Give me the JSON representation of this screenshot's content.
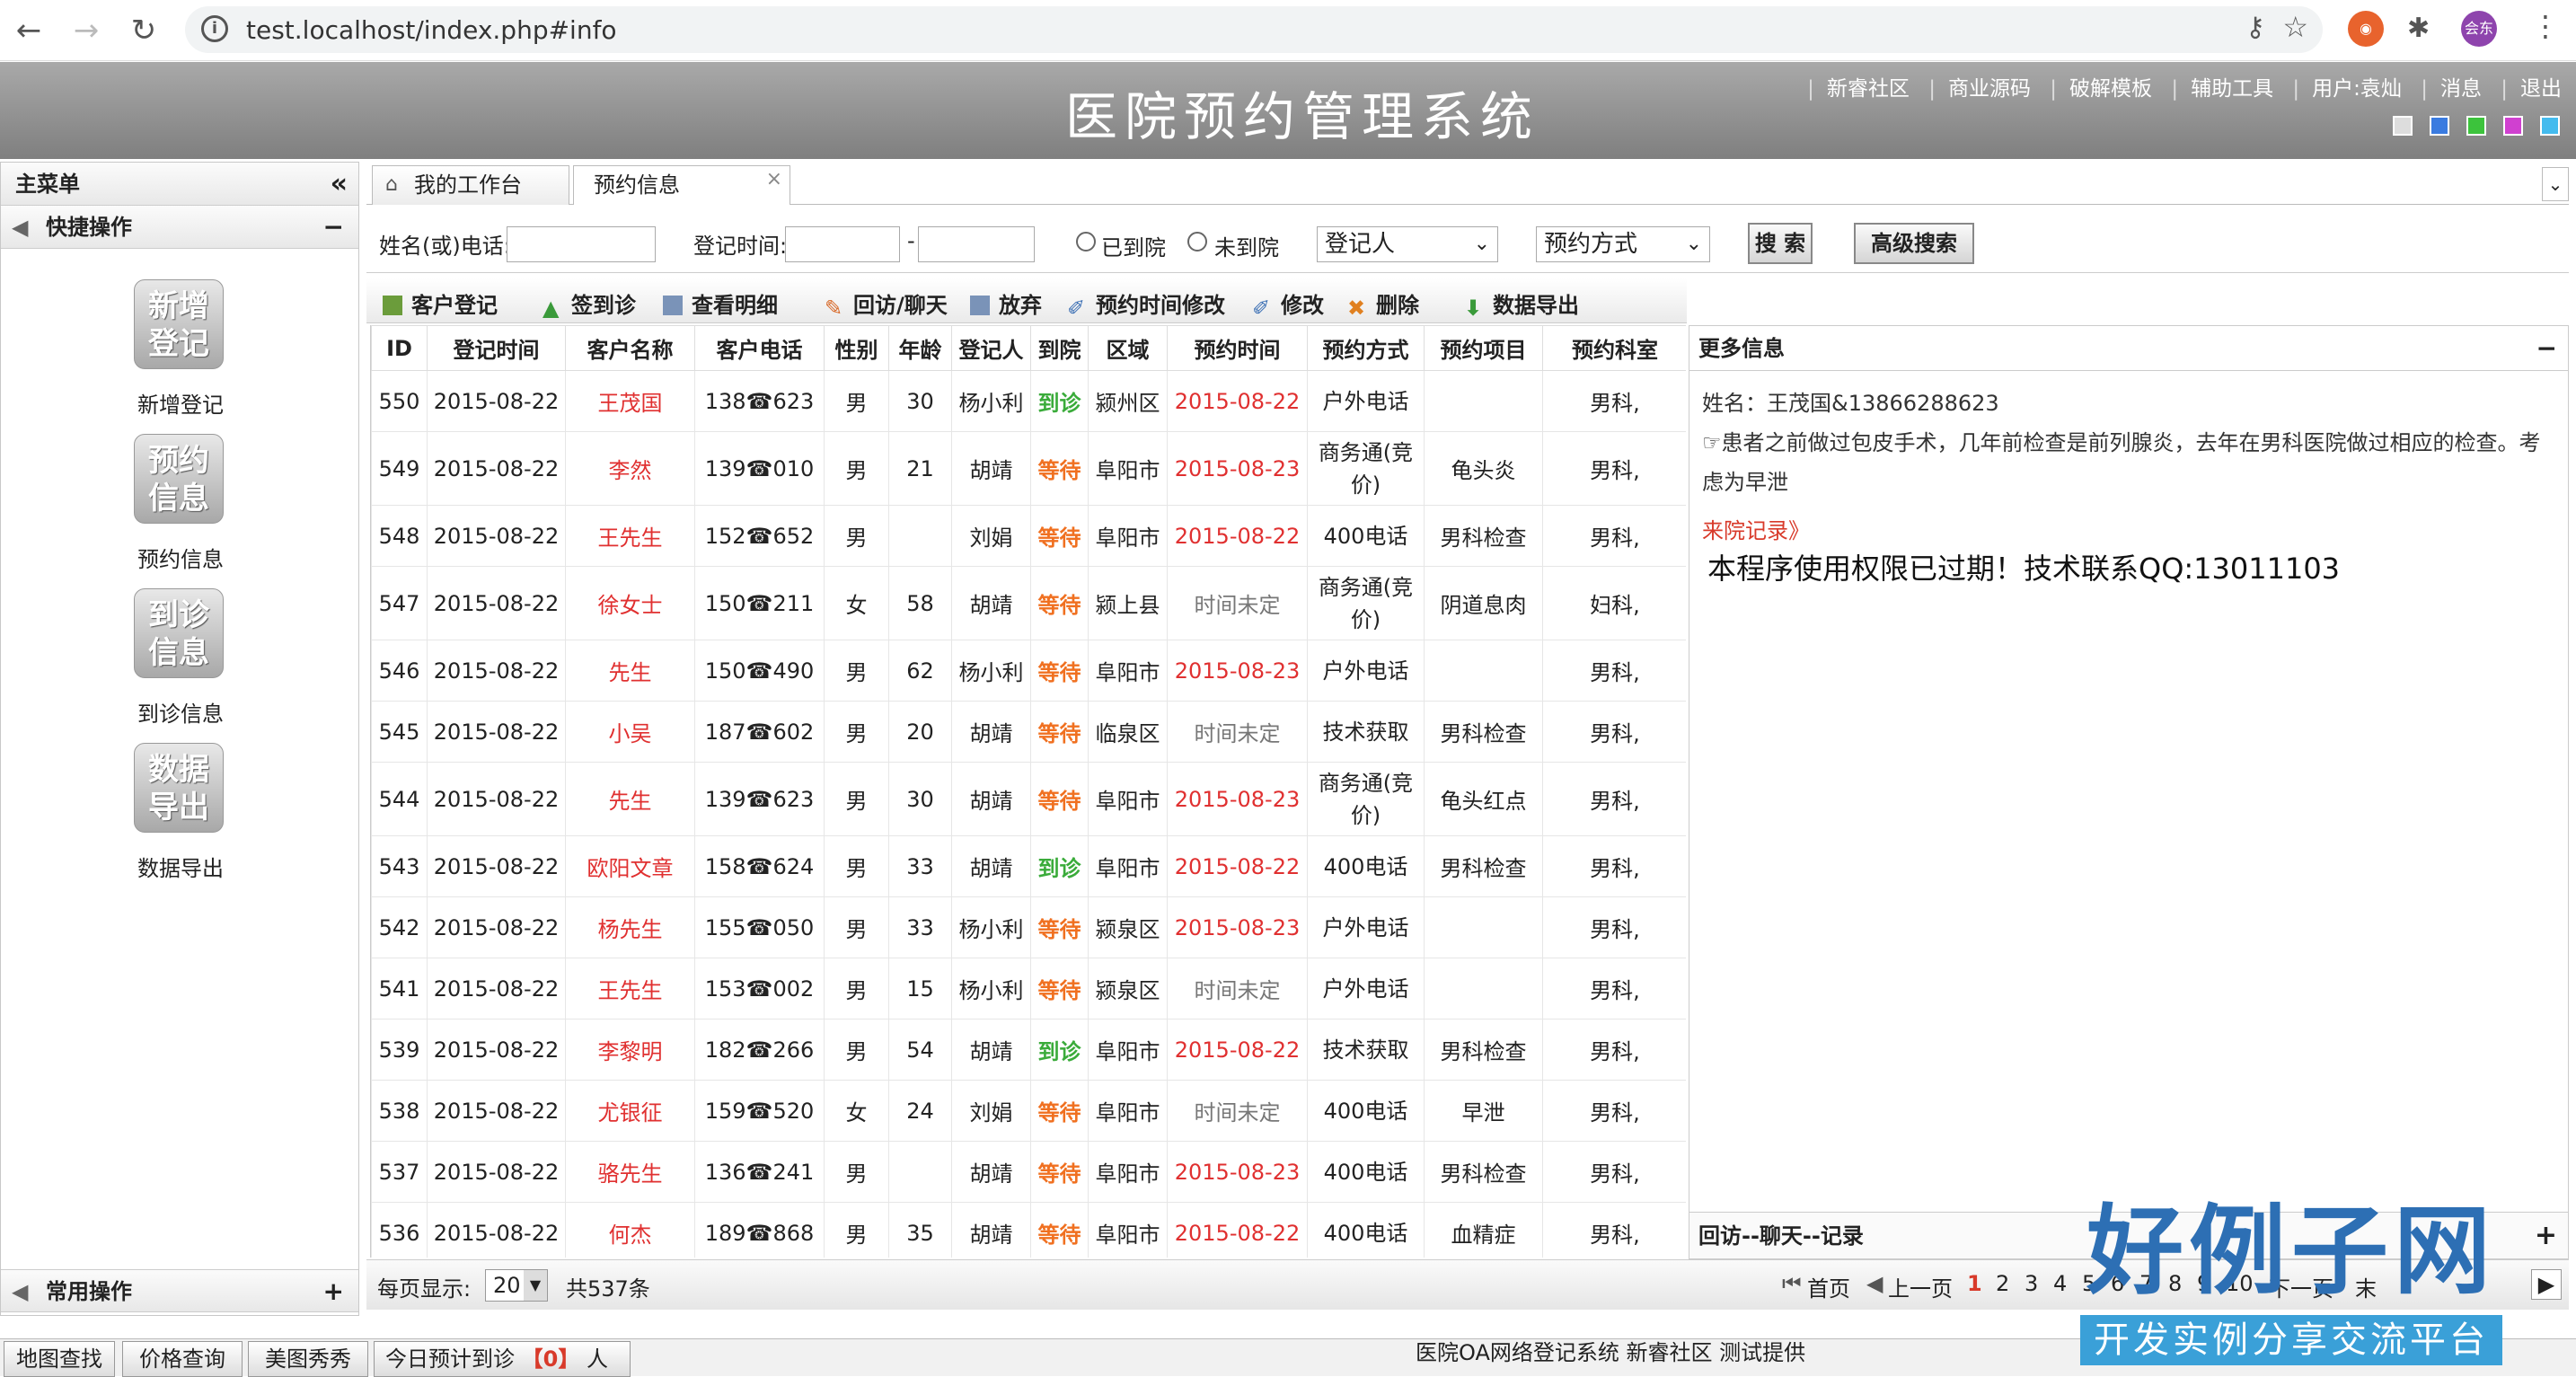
{
  "browser": {
    "url": "test.localhost/index.php#info",
    "profile_label": "会东"
  },
  "header": {
    "title": "医院预约管理系统",
    "nav": [
      "新睿社区",
      "商业源码",
      "破解模板",
      "辅助工具",
      "用户:袁灿",
      "消息",
      "退出"
    ],
    "skin_colors": [
      "#dddddd",
      "#3a7be0",
      "#3cc33c",
      "#d040d0",
      "#44bbee"
    ]
  },
  "sidebar": {
    "main_menu": "主菜单",
    "quick_ops": "快捷操作",
    "items": [
      {
        "icon_text": "新增\n登记",
        "label": "新增登记"
      },
      {
        "icon_text": "预约\n信息",
        "label": "预约信息"
      },
      {
        "icon_text": "到诊\n信息",
        "label": "到诊信息"
      },
      {
        "icon_text": "数据\n导出",
        "label": "数据导出"
      }
    ],
    "common_ops": "常用操作"
  },
  "tabs": [
    {
      "label": "我的工作台"
    },
    {
      "label": "预约信息"
    }
  ],
  "search": {
    "name_phone_label": "姓名(或)电话:",
    "reg_time_label": "登记时间:",
    "dash": "-",
    "radio_arrived": "已到院",
    "radio_not_arrived": "未到院",
    "registrar_select": "登记人",
    "method_select": "预约方式",
    "search_btn": "搜 索",
    "advanced_btn": "高级搜索"
  },
  "toolbar": [
    "客户登记",
    "签到诊",
    "查看明细",
    "回访/聊天",
    "放弃",
    "预约时间修改",
    "修改",
    "删除",
    "数据导出"
  ],
  "table": {
    "columns": [
      "ID",
      "登记时间",
      "客户名称",
      "客户电话",
      "性别",
      "年龄",
      "登记人",
      "到院",
      "区域",
      "预约时间",
      "预约方式",
      "预约项目",
      "预约科室"
    ],
    "rows": [
      [
        "550",
        "2015-08-22",
        "王茂国",
        "138☎623",
        "男",
        "30",
        "杨小利",
        "到诊",
        "颍州区",
        "2015-08-22",
        "户外电话",
        "",
        "男科,"
      ],
      [
        "549",
        "2015-08-22",
        "李然",
        "139☎010",
        "男",
        "21",
        "胡靖",
        "等待",
        "阜阳市",
        "2015-08-23",
        "商务通(竞价)",
        "龟头炎",
        "男科,"
      ],
      [
        "548",
        "2015-08-22",
        "王先生",
        "152☎652",
        "男",
        "",
        "刘娟",
        "等待",
        "阜阳市",
        "2015-08-22",
        "400电话",
        "男科检查",
        "男科,"
      ],
      [
        "547",
        "2015-08-22",
        "徐女士",
        "150☎211",
        "女",
        "58",
        "胡靖",
        "等待",
        "颍上县",
        "时间未定",
        "商务通(竞价)",
        "阴道息肉",
        "妇科,"
      ],
      [
        "546",
        "2015-08-22",
        "先生",
        "150☎490",
        "男",
        "62",
        "杨小利",
        "等待",
        "阜阳市",
        "2015-08-23",
        "户外电话",
        "",
        "男科,"
      ],
      [
        "545",
        "2015-08-22",
        "小吴",
        "187☎602",
        "男",
        "20",
        "胡靖",
        "等待",
        "临泉区",
        "时间未定",
        "技术获取",
        "男科检查",
        "男科,"
      ],
      [
        "544",
        "2015-08-22",
        "先生",
        "139☎623",
        "男",
        "30",
        "胡靖",
        "等待",
        "阜阳市",
        "2015-08-23",
        "商务通(竞价)",
        "龟头红点",
        "男科,"
      ],
      [
        "543",
        "2015-08-22",
        "欧阳文章",
        "158☎624",
        "男",
        "33",
        "胡靖",
        "到诊",
        "阜阳市",
        "2015-08-22",
        "400电话",
        "男科检查",
        "男科,"
      ],
      [
        "542",
        "2015-08-22",
        "杨先生",
        "155☎050",
        "男",
        "33",
        "杨小利",
        "等待",
        "颍泉区",
        "2015-08-23",
        "户外电话",
        "",
        "男科,"
      ],
      [
        "541",
        "2015-08-22",
        "王先生",
        "153☎002",
        "男",
        "15",
        "杨小利",
        "等待",
        "颍泉区",
        "时间未定",
        "户外电话",
        "",
        "男科,"
      ],
      [
        "539",
        "2015-08-22",
        "李黎明",
        "182☎266",
        "男",
        "54",
        "胡靖",
        "到诊",
        "阜阳市",
        "2015-08-22",
        "技术获取",
        "男科检查",
        "男科,"
      ],
      [
        "538",
        "2015-08-22",
        "尤银征",
        "159☎520",
        "女",
        "24",
        "刘娟",
        "等待",
        "阜阳市",
        "时间未定",
        "400电话",
        "早泄",
        "男科,"
      ],
      [
        "537",
        "2015-08-22",
        "骆先生",
        "136☎241",
        "男",
        "",
        "胡靖",
        "等待",
        "阜阳市",
        "2015-08-23",
        "400电话",
        "男科检查",
        "男科,"
      ],
      [
        "536",
        "2015-08-22",
        "何杰",
        "189☎868",
        "男",
        "35",
        "胡靖",
        "等待",
        "阜阳市",
        "2015-08-22",
        "400电话",
        "血精症",
        "男科,"
      ]
    ]
  },
  "more_info": {
    "title": "更多信息",
    "name_line": "姓名：王茂国&13866288623",
    "note": "☞患者之前做过包皮手术，几年前检查是前列腺炎，去年在男科医院做过相应的检查。考虑为早泄",
    "visit_link": "来院记录》",
    "expired_msg": "本程序使用权限已过期！技术联系QQ:13011103",
    "followup_title": "回访--聊天--记录"
  },
  "pager": {
    "per_page_label": "每页显示:",
    "per_page_value": "20",
    "total": "共537条",
    "first": "首页",
    "prev": "上一页",
    "pages": [
      "1",
      "2",
      "3",
      "4",
      "5",
      "6",
      "7",
      "8",
      "9",
      "10"
    ],
    "next": "下一页",
    "last": "末"
  },
  "bottom": {
    "tabs": [
      "地图查找",
      "价格查询",
      "美图秀秀"
    ],
    "today_label": "今日预计到诊",
    "today_count": "【0】",
    "today_unit": "人",
    "footer": "医院OA网络登记系统 新睿社区 测试提供"
  },
  "watermark": {
    "big": "好例子网",
    "small": "开发实例分享交流平台"
  }
}
